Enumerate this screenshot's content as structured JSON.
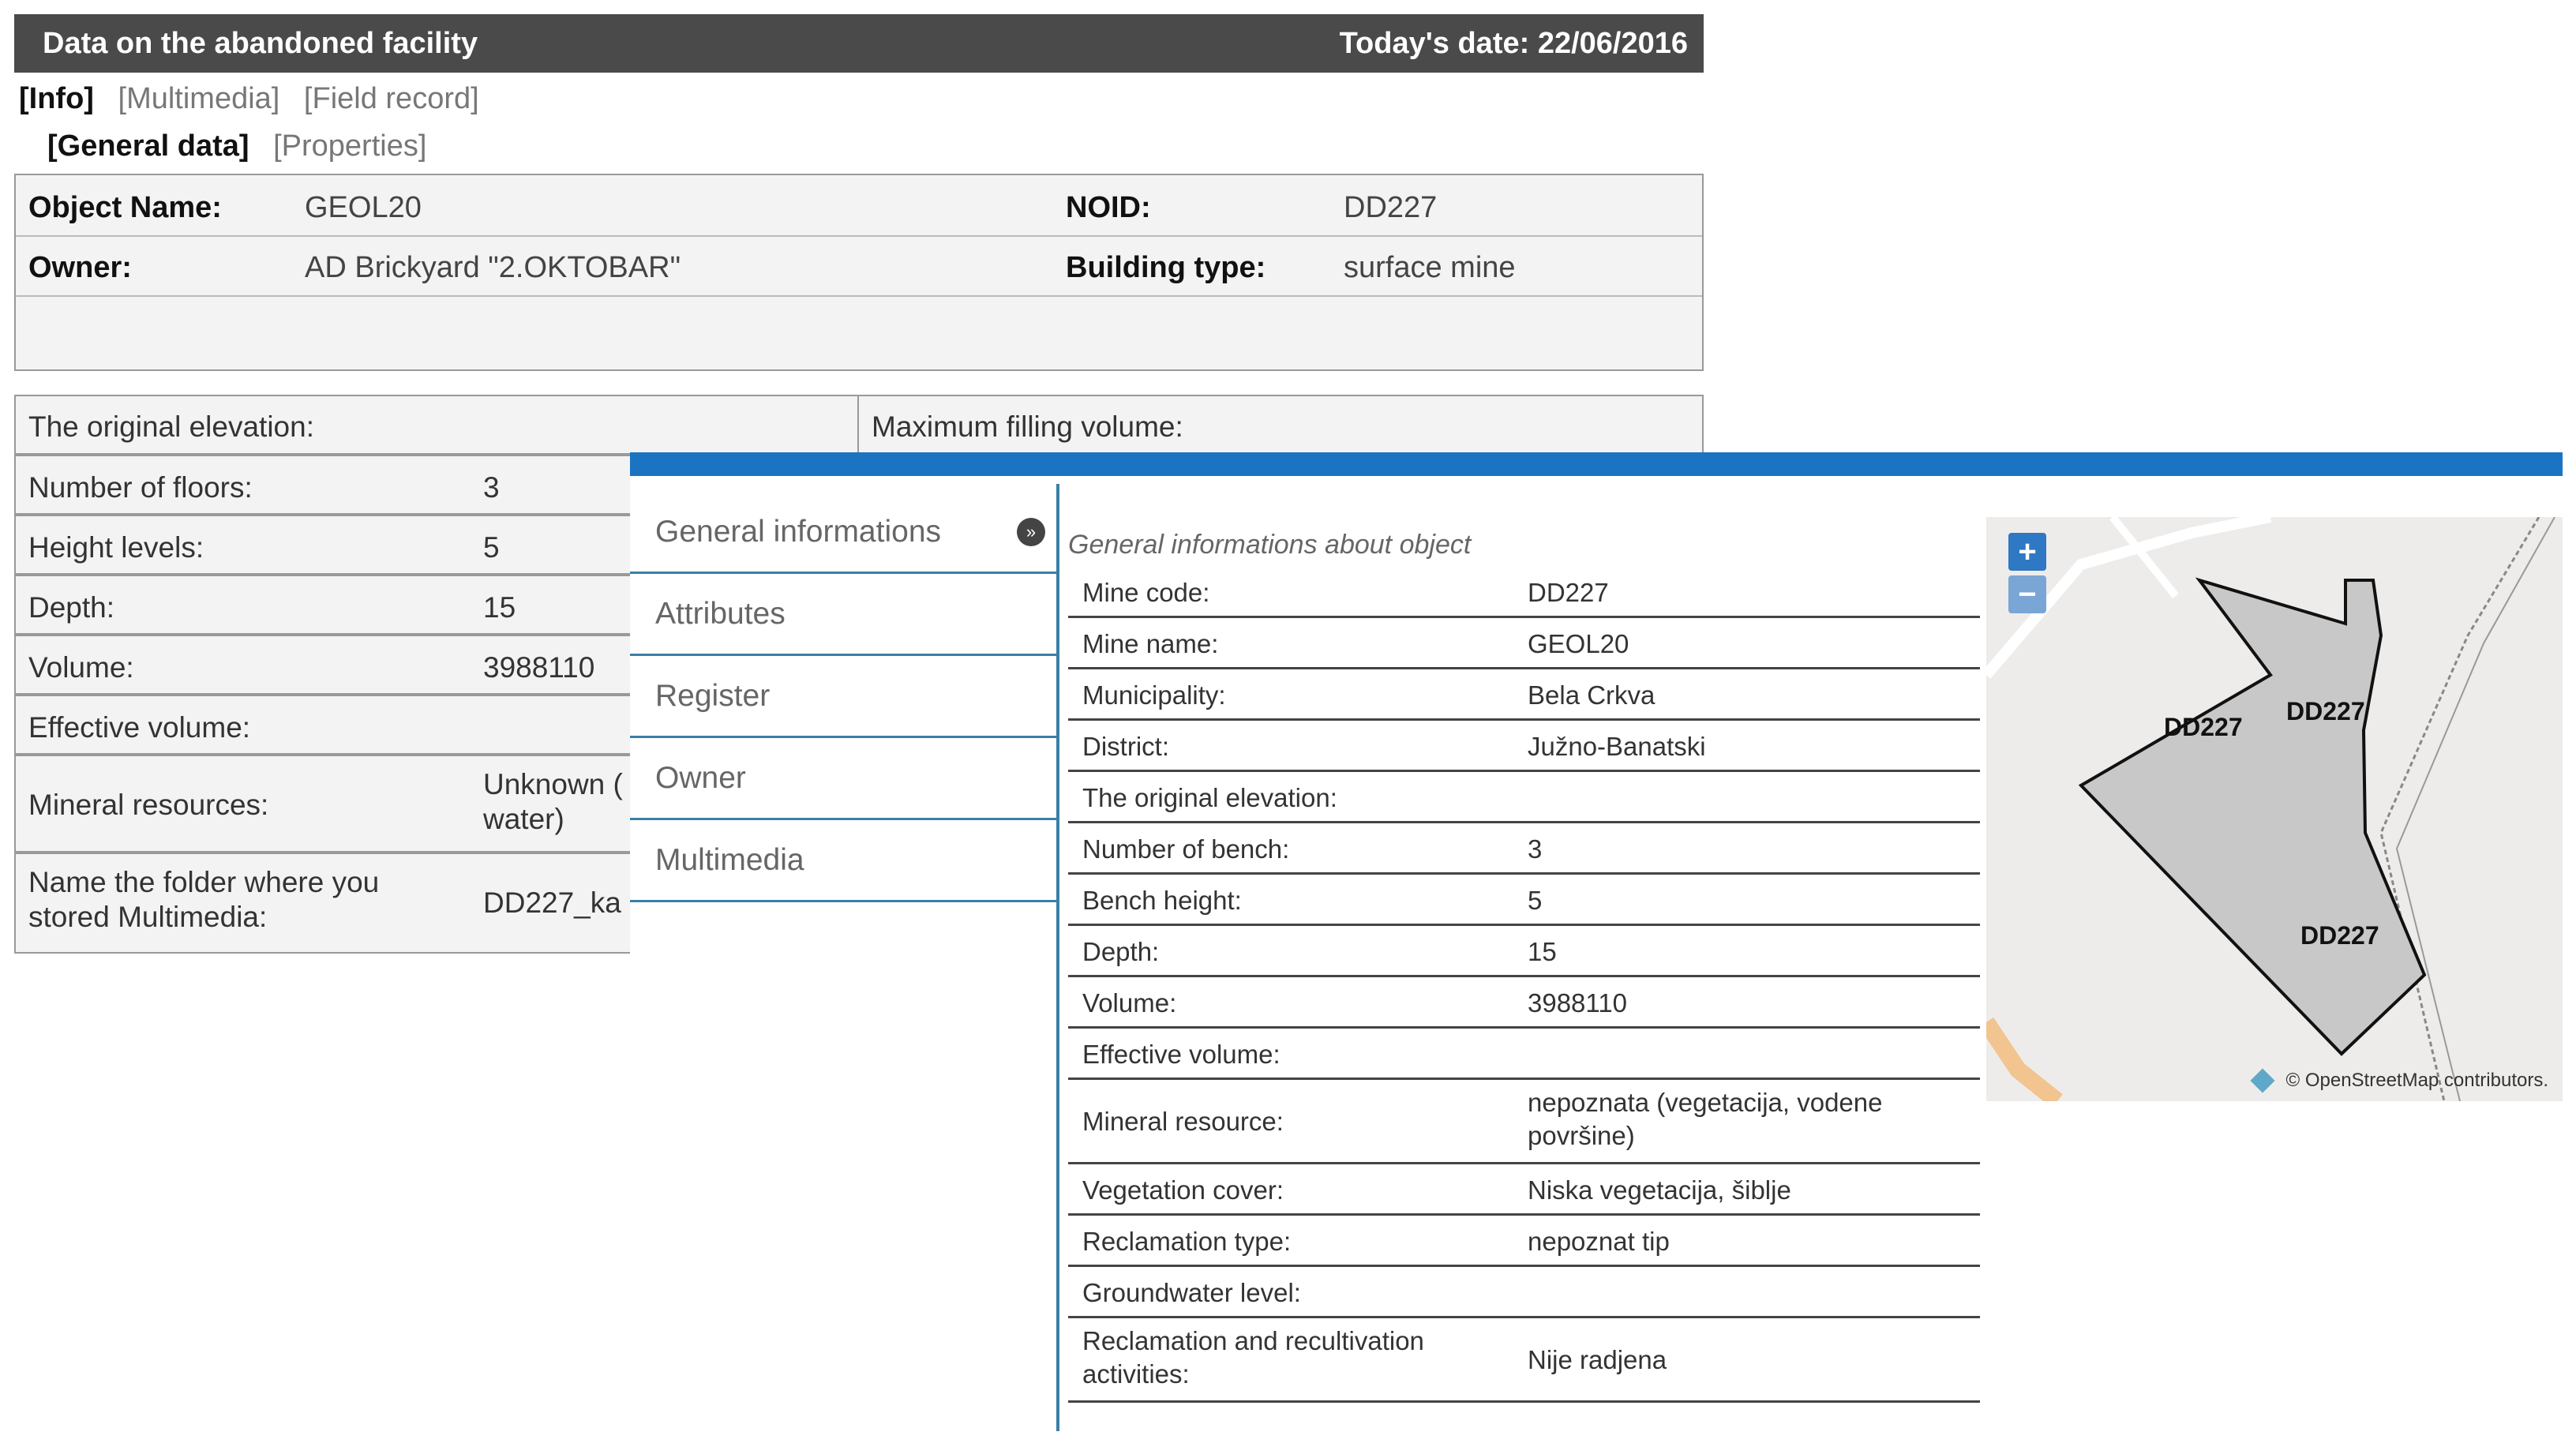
{
  "header": {
    "title": "Data on the abandoned facility",
    "date": "Today's date: 22/06/2016"
  },
  "tabs": [
    "[Info]",
    "[Multimedia]",
    "[Field record]"
  ],
  "subtabs": [
    "[General data]",
    "[Properties]"
  ],
  "general": {
    "object_name_label": "Object Name:",
    "object_name": "GEOL20",
    "noid_label": "NOID:",
    "noid": "DD227",
    "owner_label": "Owner:",
    "owner": "AD Brickyard \"2.OKTOBAR\"",
    "building_type_label": "Building type:",
    "building_type": "surface mine"
  },
  "properties": {
    "original_elevation": "The original elevation:",
    "max_filling_volume": "Maximum filling volume:",
    "rows": [
      {
        "label": "Number of floors:",
        "value": "3"
      },
      {
        "label": "Height levels:",
        "value": "5"
      },
      {
        "label": "Depth:",
        "value": "15"
      },
      {
        "label": "Volume:",
        "value": "3988110"
      },
      {
        "label": "Effective volume:",
        "value": ""
      },
      {
        "label": "Mineral resources:",
        "value": "Unknown (\nwater)"
      },
      {
        "label": "Name the folder where you\nstored Multimedia:",
        "value": "DD227_ka"
      }
    ]
  },
  "front": {
    "nav": [
      "General informations",
      "Attributes",
      "Register",
      "Owner",
      "Multimedia"
    ],
    "info_title": "General informations about object",
    "rows": [
      {
        "label": "Mine code:",
        "value": "DD227"
      },
      {
        "label": "Mine name:",
        "value": "GEOL20"
      },
      {
        "label": "Municipality:",
        "value": "Bela Crkva"
      },
      {
        "label": "District:",
        "value": "Južno-Banatski"
      },
      {
        "label": "The original elevation:",
        "value": ""
      },
      {
        "label": "Number of bench:",
        "value": "3"
      },
      {
        "label": "Bench height:",
        "value": "5"
      },
      {
        "label": "Depth:",
        "value": "15"
      },
      {
        "label": "Volume:",
        "value": "3988110"
      },
      {
        "label": "Effective volume:",
        "value": ""
      },
      {
        "label": "Mineral resource:",
        "value": "nepoznata (vegetacija, vodene\npovršine)"
      },
      {
        "label": "Vegetation cover:",
        "value": "Niska vegetacija, šiblje"
      },
      {
        "label": "Reclamation type:",
        "value": "nepoznat tip"
      },
      {
        "label": "Groundwater level:",
        "value": ""
      },
      {
        "label": "Reclamation and recultivation\nactivities:",
        "value": "Nije radjena"
      }
    ]
  },
  "map": {
    "zoom_in": "+",
    "zoom_out": "−",
    "labels": [
      "DD227",
      "DD227",
      "DD227"
    ],
    "attribution": "© OpenStreetMap contributors."
  },
  "colors": {
    "header_bg": "#4a4a4a",
    "accent_blue": "#1a74c2",
    "divider": "#3a7fa8"
  }
}
